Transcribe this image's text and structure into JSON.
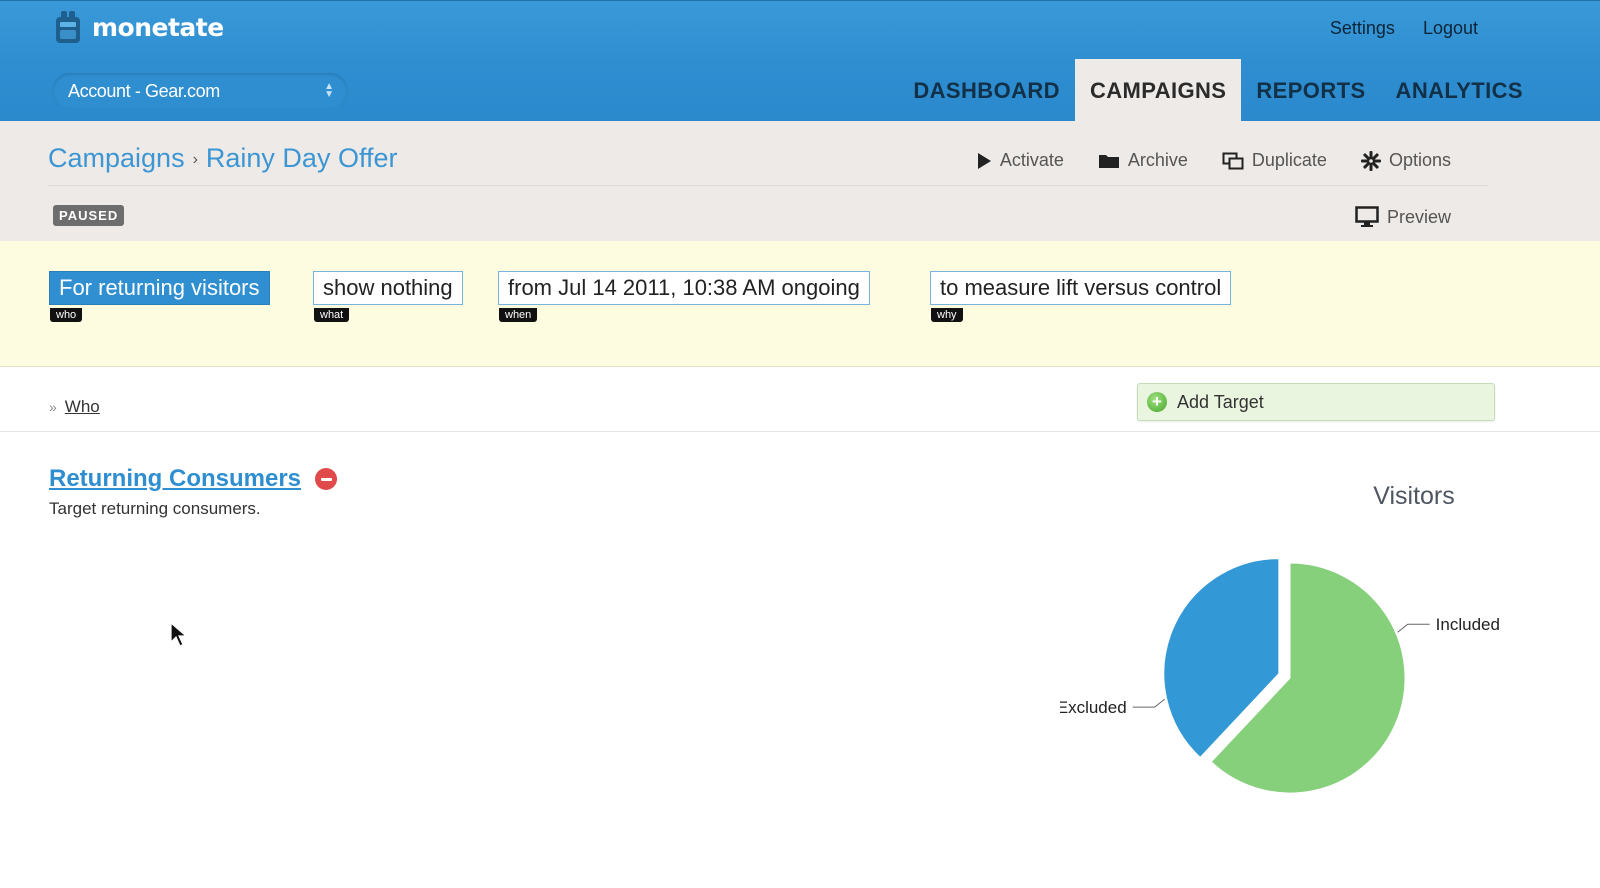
{
  "brand": {
    "name": "monetate"
  },
  "top_links": [
    {
      "id": "settings",
      "label": "Settings"
    },
    {
      "id": "logout",
      "label": "Logout"
    }
  ],
  "account": {
    "label": "Account - Gear.com"
  },
  "nav": {
    "tabs": [
      {
        "id": "dashboard",
        "label": "DASHBOARD",
        "active": false
      },
      {
        "id": "campaigns",
        "label": "CAMPAIGNS",
        "active": true
      },
      {
        "id": "reports",
        "label": "REPORTS",
        "active": false
      },
      {
        "id": "analytics",
        "label": "ANALYTICS",
        "active": false
      }
    ]
  },
  "breadcrumb": {
    "root": "Campaigns",
    "separator": "›",
    "current": "Rainy Day Offer"
  },
  "actions": [
    {
      "id": "activate",
      "label": "Activate",
      "icon": "play-icon"
    },
    {
      "id": "archive",
      "label": "Archive",
      "icon": "folder-icon"
    },
    {
      "id": "duplicate",
      "label": "Duplicate",
      "icon": "duplicate-icon"
    },
    {
      "id": "options",
      "label": "Options",
      "icon": "gear-icon"
    }
  ],
  "status": {
    "label": "PAUSED"
  },
  "preview": {
    "label": "Preview",
    "icon": "monitor-icon"
  },
  "summary": {
    "who": {
      "text": "For returning visitors",
      "tag": "who"
    },
    "what": {
      "text": "show nothing",
      "tag": "what"
    },
    "when": {
      "text": "from Jul 14 2011, 10:38 AM ongoing",
      "tag": "when"
    },
    "why": {
      "text": "to measure lift versus control",
      "tag": "why"
    }
  },
  "who_section": {
    "marker": "»",
    "label": "Who",
    "add_target_label": "Add Target"
  },
  "segment": {
    "name": "Returning Consumers",
    "description": "Target returning consumers."
  },
  "colors": {
    "header_blue": "#2f8fd1",
    "included": "#86cf7b",
    "excluded": "#3399d6"
  },
  "chart_data": {
    "type": "pie",
    "title": "Visitors",
    "slices": [
      {
        "label": "Included",
        "value": 62,
        "color": "#86cf7b"
      },
      {
        "label": "Excluded",
        "value": 38,
        "color": "#3399d6",
        "exploded": true
      }
    ]
  }
}
